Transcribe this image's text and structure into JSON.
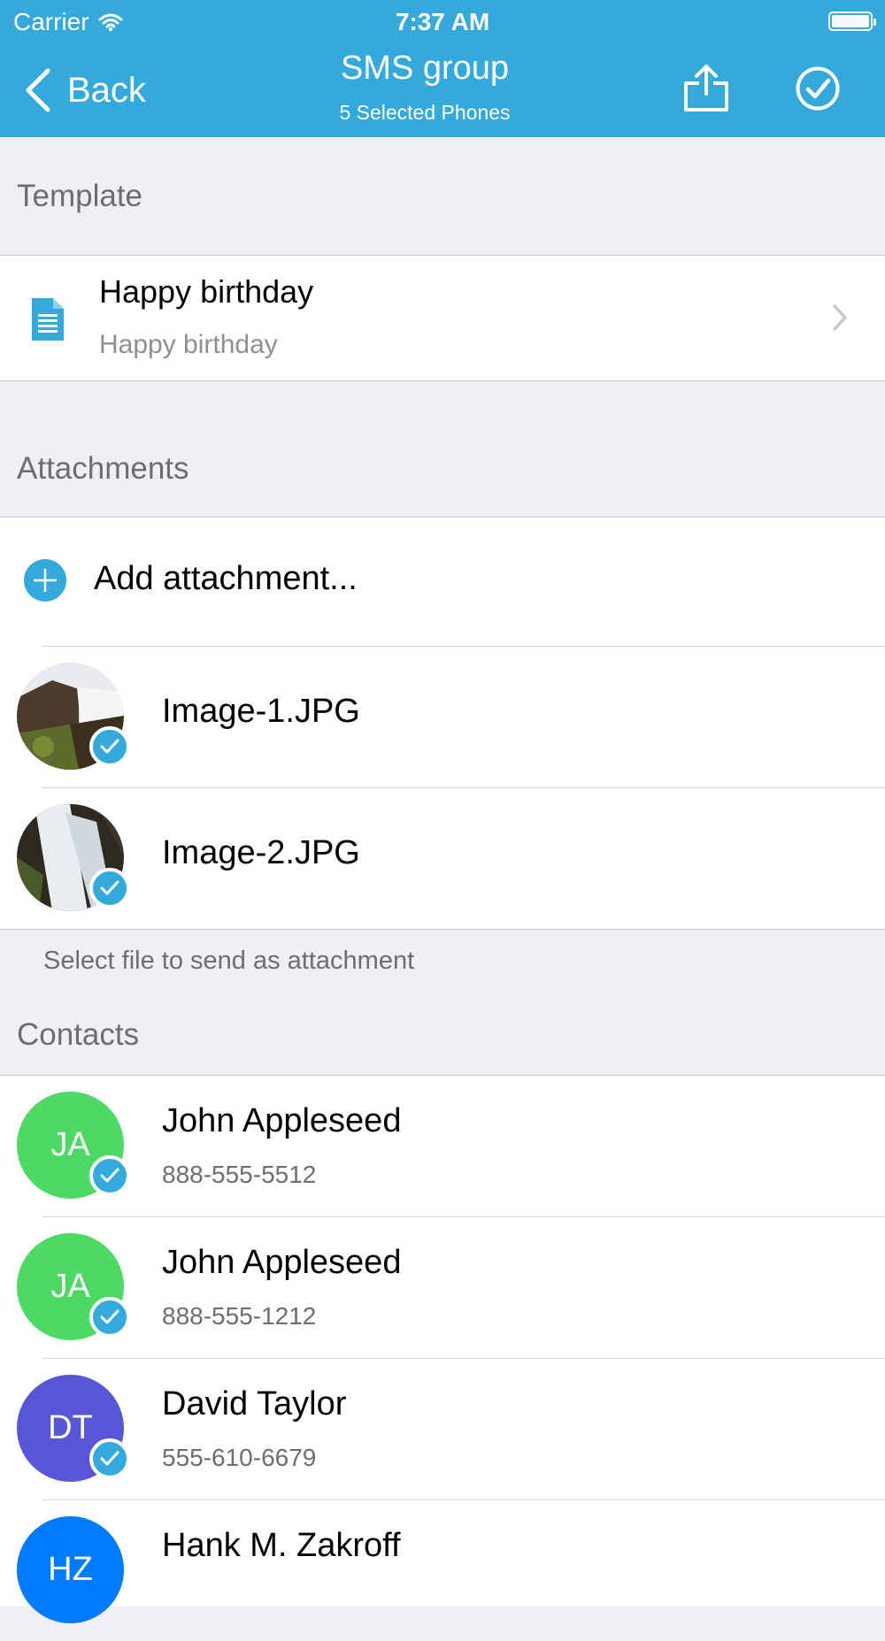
{
  "status_bar": {
    "carrier": "Carrier",
    "time": "7:37 AM"
  },
  "nav": {
    "back_label": "Back",
    "title": "SMS group",
    "subtitle": "5 Selected Phones"
  },
  "template_section": {
    "header": "Template",
    "item": {
      "title": "Happy birthday",
      "subtitle": "Happy birthday",
      "icon": "document-icon"
    }
  },
  "attachments_section": {
    "header": "Attachments",
    "add_label": "Add attachment...",
    "files": [
      {
        "name": "Image-1.JPG",
        "selected": true
      },
      {
        "name": "Image-2.JPG",
        "selected": true
      }
    ],
    "footer": "Select file to send as attachment"
  },
  "contacts_section": {
    "header": "Contacts",
    "contacts": [
      {
        "initials": "JA",
        "name": "John Appleseed",
        "phone": "888-555-5512",
        "color": "#4cd964",
        "selected": true
      },
      {
        "initials": "JA",
        "name": "John Appleseed",
        "phone": "888-555-1212",
        "color": "#4cd964",
        "selected": true
      },
      {
        "initials": "DT",
        "name": "David Taylor",
        "phone": "555-610-6679",
        "color": "#5856d6",
        "selected": true
      },
      {
        "initials": "HZ",
        "name": "Hank M. Zakroff",
        "phone": "",
        "color": "#007aff",
        "selected": true
      }
    ]
  },
  "colors": {
    "accent": "#34aadc",
    "background": "#efeff4"
  }
}
